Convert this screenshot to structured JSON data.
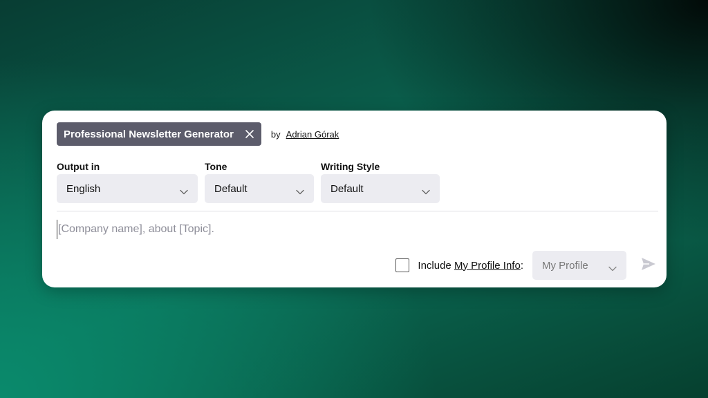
{
  "prompt": {
    "title": "Professional Newsletter Generator",
    "by_label": "by",
    "author": "Adrian Górak"
  },
  "fields": {
    "output_label": "Output in",
    "output_value": "English",
    "tone_label": "Tone",
    "tone_value": "Default",
    "style_label": "Writing Style",
    "style_value": "Default"
  },
  "input": {
    "placeholder": "[Company name], about [Topic]."
  },
  "footer": {
    "include_label": "Include",
    "profile_link": "My Profile Info",
    "colon": ":",
    "profile_select": "My Profile"
  },
  "icons": {
    "close": "close-icon",
    "chevron": "chevron-down-icon",
    "send": "send-icon"
  }
}
